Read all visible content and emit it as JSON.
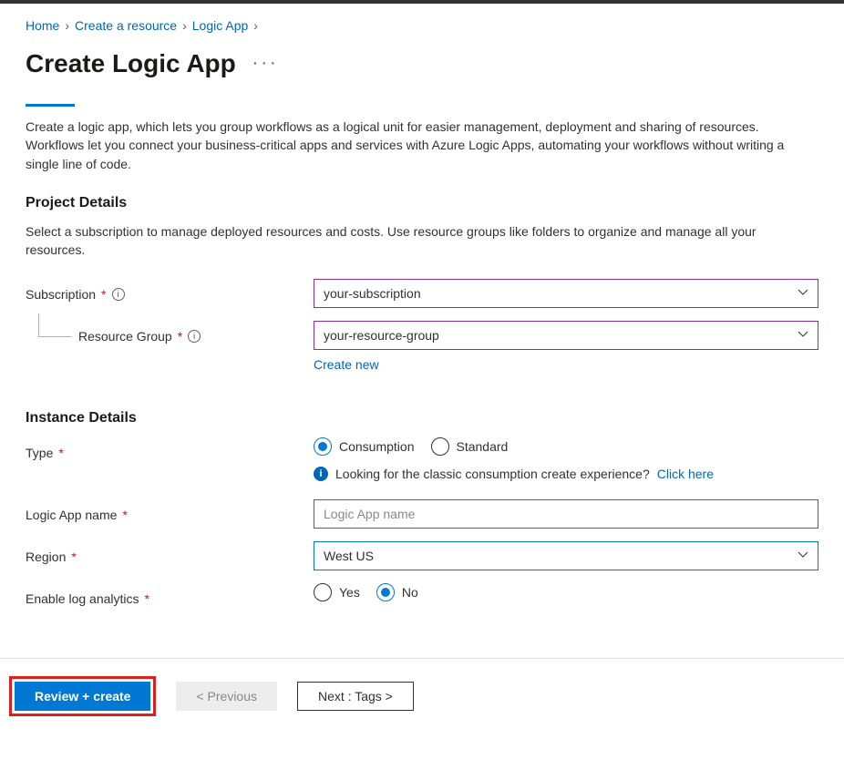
{
  "breadcrumb": {
    "home": "Home",
    "create_resource": "Create a resource",
    "logic_app": "Logic App"
  },
  "page_title": "Create Logic App",
  "description": "Create a logic app, which lets you group workflows as a logical unit for easier management, deployment and sharing of resources. Workflows let you connect your business-critical apps and services with Azure Logic Apps, automating your workflows without writing a single line of code.",
  "project": {
    "title": "Project Details",
    "desc": "Select a subscription to manage deployed resources and costs. Use resource groups like folders to organize and manage all your resources.",
    "subscription_label": "Subscription",
    "subscription_value": "your-subscription",
    "rg_label": "Resource Group",
    "rg_value": "your-resource-group",
    "create_new": "Create new"
  },
  "instance": {
    "title": "Instance Details",
    "type_label": "Type",
    "type_consumption": "Consumption",
    "type_standard": "Standard",
    "classic_text": "Looking for the classic consumption create experience?",
    "classic_link": "Click here",
    "name_label": "Logic App name",
    "name_placeholder": "Logic App name",
    "region_label": "Region",
    "region_value": "West US",
    "analytics_label": "Enable log analytics",
    "analytics_yes": "Yes",
    "analytics_no": "No"
  },
  "footer": {
    "review": "Review + create",
    "previous": "< Previous",
    "next": "Next : Tags >"
  }
}
